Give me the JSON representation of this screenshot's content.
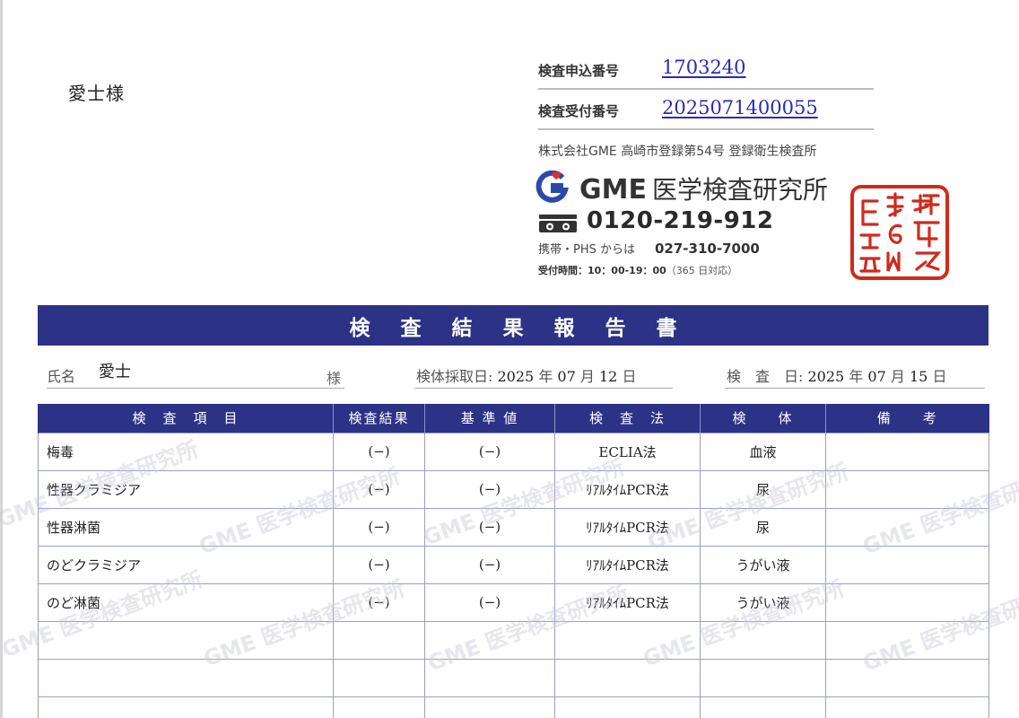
{
  "addressee": "愛士様",
  "request_number": {
    "label": "検査申込番号",
    "value": "1703240"
  },
  "receipt_number": {
    "label": "検査受付番号",
    "value": "2025071400055"
  },
  "company_registration": "株式会社GME  高崎市登録第54号  登録衛生検査所",
  "brand": {
    "name": "GME",
    "suffix": "医学検査研究所"
  },
  "phone": {
    "freedial": "0120-219-912",
    "mobile_label": "携帯・PHS からは",
    "mobile_number": "027-310-7000"
  },
  "hours": {
    "text": "受付時間：10：00-19：00",
    "note": "（365 日対応）"
  },
  "seal_text": "株式会社GME上野印",
  "title": "検査結果報告書",
  "patient": {
    "name_label": "氏名",
    "name": "愛士",
    "honorific": "様"
  },
  "collection": {
    "label": "検体採取日:",
    "year": "2025",
    "month": "07",
    "day": "12",
    "y": "年",
    "m": "月",
    "d": "日"
  },
  "test": {
    "label": "検　査　日:",
    "year": "2025",
    "month": "07",
    "day": "15",
    "y": "年",
    "m": "月",
    "d": "日"
  },
  "table": {
    "headers": [
      "検　査　項　目",
      "検査結果",
      "基 準 値",
      "検　査　法",
      "検　　体",
      "備　　考"
    ],
    "rows": [
      {
        "item": "梅毒",
        "result": "(−)",
        "reference": "(−)",
        "method": "ECLIA法",
        "specimen": "血液",
        "note": ""
      },
      {
        "item": "性器クラミジア",
        "result": "(−)",
        "reference": "(−)",
        "method": "ﾘｱﾙﾀｲﾑPCR法",
        "specimen": "尿",
        "note": ""
      },
      {
        "item": "性器淋菌",
        "result": "(−)",
        "reference": "(−)",
        "method": "ﾘｱﾙﾀｲﾑPCR法",
        "specimen": "尿",
        "note": ""
      },
      {
        "item": "のどクラミジア",
        "result": "(−)",
        "reference": "(−)",
        "method": "ﾘｱﾙﾀｲﾑPCR法",
        "specimen": "うがい液",
        "note": ""
      },
      {
        "item": "のど淋菌",
        "result": "(−)",
        "reference": "(−)",
        "method": "ﾘｱﾙﾀｲﾑPCR法",
        "specimen": "うがい液",
        "note": ""
      },
      {
        "item": "",
        "result": "",
        "reference": "",
        "method": "",
        "specimen": "",
        "note": ""
      },
      {
        "item": "",
        "result": "",
        "reference": "",
        "method": "",
        "specimen": "",
        "note": ""
      },
      {
        "item": "",
        "result": "",
        "reference": "",
        "method": "",
        "specimen": "",
        "note": ""
      }
    ]
  },
  "watermark": "GME 医学検査研究所",
  "colors": {
    "header_navy": "#2c3286",
    "number_blue": "#2a2ab8",
    "seal_red": "#cf2a1e",
    "logo_blue": "#2b4aa8",
    "logo_red": "#d8322a"
  }
}
